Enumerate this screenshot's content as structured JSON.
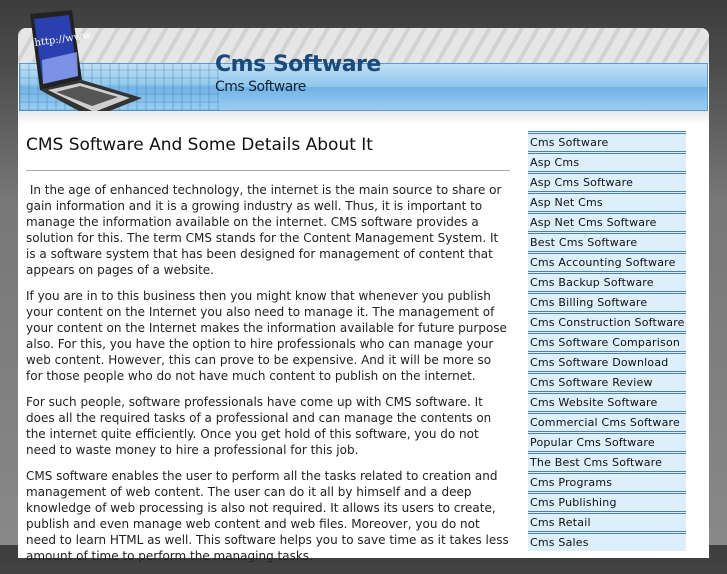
{
  "header": {
    "title": "Cms Software",
    "subtitle": "Cms Software",
    "logo_text": "http://www"
  },
  "article": {
    "title": "CMS Software And Some Details About It",
    "paragraphs": [
      " In the age of enhanced technology, the internet is the main source to share or gain information and it is a growing industry as well. Thus, it is important to manage the information available on the internet. CMS software provides a solution for this. The term CMS stands for the Content Management System. It is a software system that has been designed for management of content that appears on pages of a website.",
      "If you are in to this business then you might know that whenever you publish your content on the Internet you also need to manage it. The management of your content on the Internet makes the information available for future purpose also. For this, you have the option to hire professionals who can manage your web content. However, this can prove to be expensive. And it will be more so for those people who do not have much content to publish on the internet.",
      "For such people, software professionals have come up with CMS software. It does all the required tasks of a professional and can manage the contents on the internet quite efficiently. Once you get hold of this software, you do not need to waste money to hire a professional for this job.",
      "CMS software enables the user to perform all the tasks related to creation and management of web content. The user can do it all by himself and a deep knowledge of web processing is also not required. It allows its users to create, publish and even manage web content and web files. Moreover, you do not need to learn HTML as well. This software helps you to save time as it takes less amount of time to perform the managing tasks."
    ]
  },
  "sidebar": {
    "links": [
      "Cms Software",
      "Asp Cms",
      "Asp Cms Software",
      "Asp Net Cms",
      "Asp Net Cms Software",
      "Best Cms Software",
      "Cms Accounting Software",
      "Cms Backup Software",
      "Cms Billing Software",
      "Cms Construction Software",
      "Cms Software Comparison",
      "Cms Software Download",
      "Cms Software Review",
      "Cms Website Software",
      "Commercial Cms Software",
      "Popular Cms Software",
      "The Best Cms Software",
      "Cms Programs",
      "Cms Publishing",
      "Cms Retail",
      "Cms Sales"
    ]
  }
}
